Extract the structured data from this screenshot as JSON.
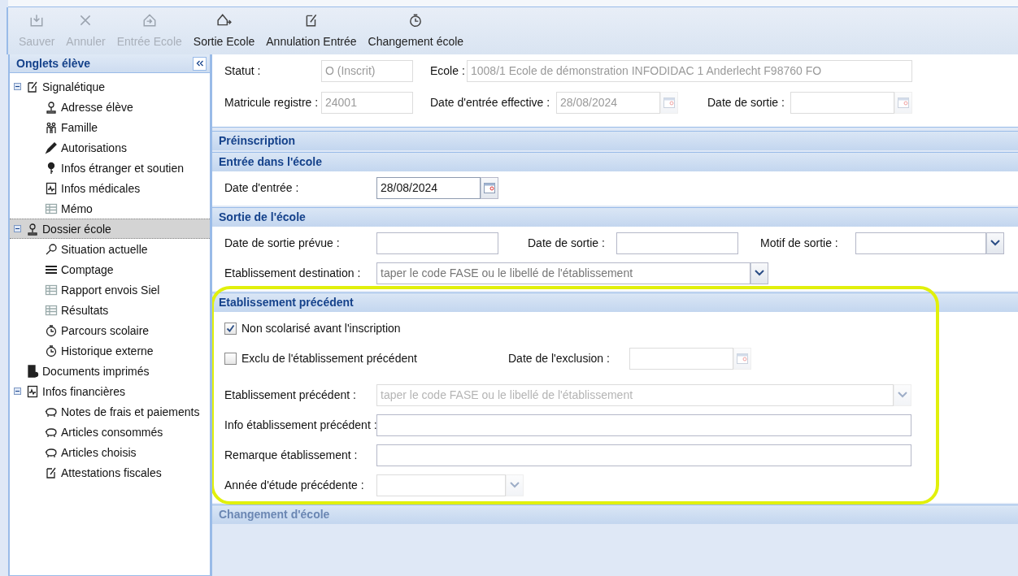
{
  "toolbar": [
    {
      "label": "Sauver",
      "kind": "save",
      "disabled": true
    },
    {
      "label": "Annuler",
      "kind": "cancel",
      "disabled": true
    },
    {
      "label": "Entrée Ecole",
      "kind": "enter",
      "disabled": true
    },
    {
      "label": "Sortie Ecole",
      "kind": "exit",
      "disabled": false
    },
    {
      "label": "Annulation Entrée",
      "kind": "edit",
      "disabled": false
    },
    {
      "label": "Changement école",
      "kind": "clock",
      "disabled": false
    }
  ],
  "sidebar": {
    "title": "Onglets élève",
    "items": [
      {
        "label": "Signalétique",
        "kind": "edit",
        "selected": false,
        "expanded": true,
        "children": [
          {
            "label": "Adresse élève",
            "kind": "pin",
            "selected": false
          },
          {
            "label": "Famille",
            "kind": "family",
            "selected": false
          },
          {
            "label": "Autorisations",
            "kind": "pencil",
            "selected": false
          },
          {
            "label": "Infos étranger et soutien",
            "kind": "key",
            "selected": false
          },
          {
            "label": "Infos médicales",
            "kind": "medical",
            "selected": false
          },
          {
            "label": "Mémo",
            "kind": "table",
            "selected": false
          }
        ]
      },
      {
        "label": "Dossier école",
        "kind": "pin",
        "selected": true,
        "expanded": true,
        "children": [
          {
            "label": "Situation actuelle",
            "kind": "search",
            "selected": false
          },
          {
            "label": "Comptage",
            "kind": "lines",
            "selected": false
          },
          {
            "label": "Rapport envois Siel",
            "kind": "table",
            "selected": false
          },
          {
            "label": "Résultats",
            "kind": "table",
            "selected": false
          },
          {
            "label": "Parcours scolaire",
            "kind": "clock",
            "selected": false
          },
          {
            "label": "Historique externe",
            "kind": "clock",
            "selected": false
          }
        ]
      },
      {
        "label": "Documents imprimés",
        "kind": "document",
        "selected": false
      },
      {
        "label": "Infos financières",
        "kind": "medical",
        "selected": false,
        "expanded": true,
        "children": [
          {
            "label": "Notes de frais et paiements",
            "kind": "piggy",
            "selected": false
          },
          {
            "label": "Articles consommés",
            "kind": "piggy",
            "selected": false
          },
          {
            "label": "Articles choisis",
            "kind": "piggy",
            "selected": false
          },
          {
            "label": "Attestations fiscales",
            "kind": "edit",
            "selected": false
          }
        ]
      }
    ]
  },
  "record": {
    "statut": {
      "label": "Statut :",
      "value": "O (Inscrit)",
      "disabled": true
    },
    "ecole": {
      "label": "Ecole :",
      "value": "1008/1 Ecole de démonstration INFODIDAC 1 Anderlecht F98760 FO",
      "disabled": true
    },
    "matricule": {
      "label": "Matricule registre :",
      "value": "24001",
      "disabled": true
    },
    "date_entree_effective": {
      "label": "Date d'entrée effective :",
      "value": "28/08/2024",
      "disabled": true
    },
    "date_sortie": {
      "label": "Date de sortie :",
      "disabled": true
    }
  },
  "sections": [
    {
      "title": "Préinscription",
      "expanded": false
    },
    {
      "kind": "entree",
      "title": "Entrée dans l'école",
      "expanded": true,
      "date_entree": {
        "label": "Date d'entrée :",
        "value": "28/08/2024",
        "disabled": false
      }
    },
    {
      "kind": "sortie",
      "title": "Sortie de l'école",
      "expanded": true,
      "date_sortie_prevue": {
        "label": "Date de sortie prévue :",
        "disabled": false
      },
      "date_sortie": {
        "label": "Date de sortie :",
        "disabled": false
      },
      "motif": {
        "label": "Motif de sortie :",
        "disabled": false
      },
      "destination": {
        "label": "Etablissement destination :",
        "placeholder": "taper le code FASE ou le libellé de l'établissement",
        "disabled": false
      }
    },
    {
      "kind": "precedent",
      "title": "Etablissement précédent",
      "expanded": true,
      "highlighted": true,
      "non_scolarise": {
        "label": "Non scolarisé avant l'inscription",
        "checked": true
      },
      "exclu": {
        "label": "Exclu de l'établissement précédent",
        "checked": false
      },
      "date_exclusion": {
        "label": "Date de l'exclusion :",
        "disabled": true
      },
      "etablissement": {
        "label": "Etablissement précédent :",
        "placeholder": "taper le code FASE ou le libellé de l'établissement",
        "disabled": true
      },
      "info": {
        "label": "Info établissement précédent :",
        "disabled": false
      },
      "remarque": {
        "label": "Remarque établissement :",
        "disabled": false
      },
      "annee": {
        "label": "Année d'étude précédente :",
        "disabled": true
      }
    },
    {
      "title": "Changement d'école",
      "expanded": false,
      "disabled": true
    }
  ]
}
